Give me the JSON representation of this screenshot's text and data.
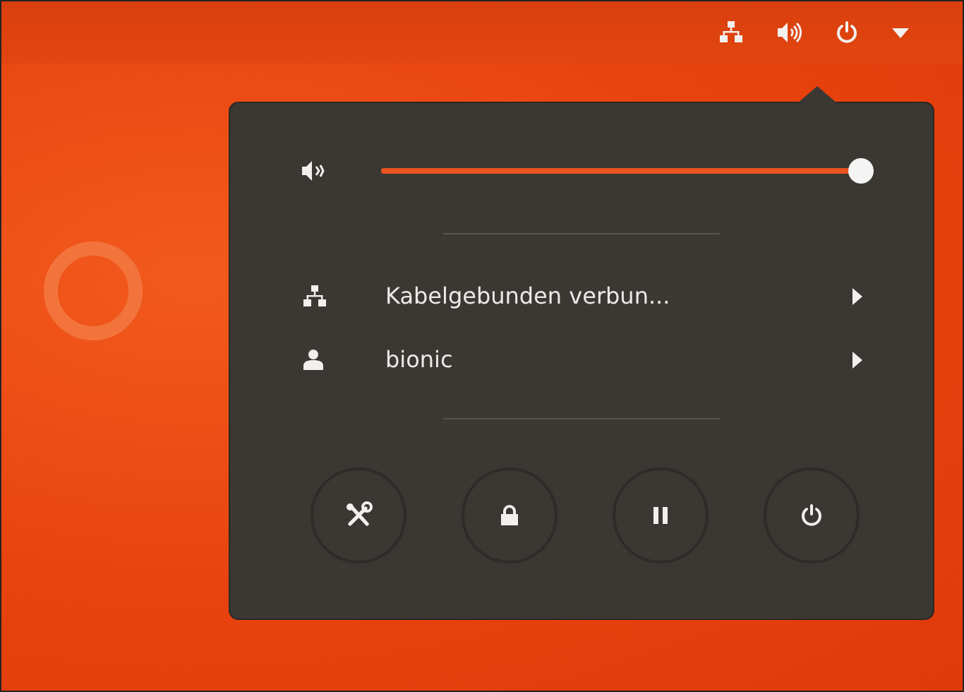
{
  "top_bar": {
    "indicators": [
      {
        "kind": "network"
      },
      {
        "kind": "volume"
      },
      {
        "kind": "power"
      },
      {
        "kind": "caret"
      }
    ]
  },
  "volume": {
    "level": 1
  },
  "menu_items": [
    {
      "kind": "network",
      "label": "Kabelgebunden verbun..."
    },
    {
      "kind": "user",
      "label": "bionic"
    }
  ],
  "actions": [
    {
      "kind": "settings"
    },
    {
      "kind": "lock"
    },
    {
      "kind": "suspend"
    },
    {
      "kind": "power"
    }
  ]
}
